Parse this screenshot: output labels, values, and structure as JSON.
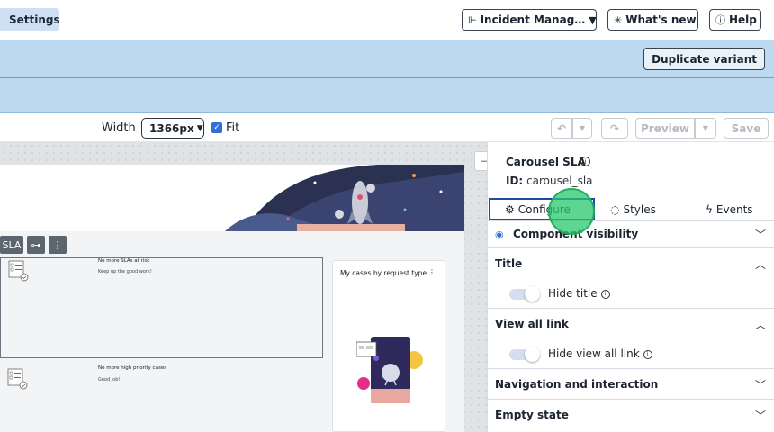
{
  "header": {
    "settings_tab": "Settings",
    "app_switcher": "Incident Manag…",
    "whats_new": "What's new",
    "help": "Help"
  },
  "band": {
    "duplicate_variant": "Duplicate variant"
  },
  "toolbar": {
    "width_label": "Width",
    "width_value": "1366px",
    "fit_label": "Fit",
    "preview": "Preview",
    "save": "Save"
  },
  "canvas": {
    "selection_label": "SLA",
    "sla_items": [
      {
        "title": "No more SLAs at risk",
        "subtitle": "Keep up the good work!"
      },
      {
        "title": "No more high priority cases",
        "subtitle": "Good job!"
      }
    ],
    "cases_card_title": "My cases by request type"
  },
  "panel": {
    "title": "Carousel SLA",
    "id_label": "ID:",
    "id_value": "carousel_sla",
    "tabs": {
      "configure": "Configure",
      "styles": "Styles",
      "events": "Events"
    },
    "sections": {
      "visibility": "Component visibility",
      "title": "Title",
      "hide_title": "Hide title",
      "view_all": "View all link",
      "hide_view_all": "Hide view all link",
      "navigation": "Navigation and interaction",
      "empty_state": "Empty state"
    }
  },
  "colors": {
    "accent": "#1e4ba8",
    "band": "#bcd9f0",
    "settings_tab": "#cfe0f5",
    "click_indicator": "#28c86e"
  }
}
